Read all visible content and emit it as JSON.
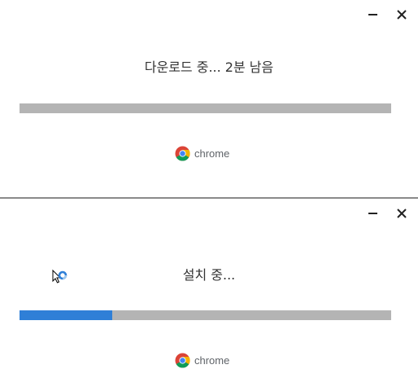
{
  "download_window": {
    "status_text": "다운로드 중... 2분 남음",
    "progress_fraction": 0.0,
    "brand_label": "chrome"
  },
  "install_window": {
    "status_text": "설치 중...",
    "progress_fraction": 0.25,
    "brand_label": "chrome"
  },
  "icons": {
    "minimize": "minimize-icon",
    "close": "close-icon",
    "logo": "chrome-logo-icon",
    "cursor": "busy-cursor-icon"
  },
  "colors": {
    "progress_fill": "#2f7fd7",
    "progress_track": "#b4b4b4",
    "text": "#333333"
  }
}
